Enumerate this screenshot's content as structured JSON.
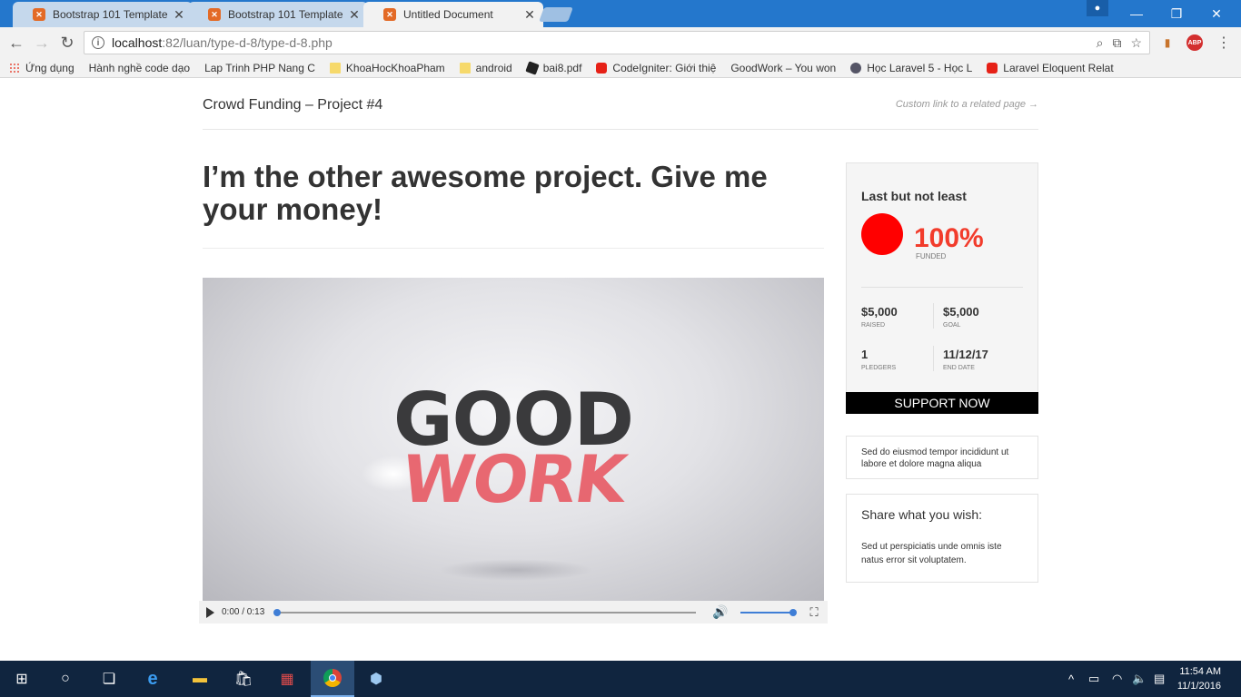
{
  "browser": {
    "tabs": [
      {
        "label": "Bootstrap 101 Template",
        "active": false
      },
      {
        "label": "Bootstrap 101 Template",
        "active": false
      },
      {
        "label": "Untitled Document",
        "active": true
      }
    ],
    "url_host": "localhost",
    "url_path": ":82/luan/type-d-8/type-d-8.php",
    "bookmarks": [
      {
        "label": "Ứng dụng",
        "icon": "apps-icon"
      },
      {
        "label": "Hành nghề code dạo",
        "icon": "page-icon"
      },
      {
        "label": "Lap Trinh PHP Nang C",
        "icon": "page-icon"
      },
      {
        "label": "KhoaHocKhoaPham",
        "icon": "folder-icon"
      },
      {
        "label": "android",
        "icon": "folder-icon"
      },
      {
        "label": "bai8.pdf",
        "icon": "pdf-icon"
      },
      {
        "label": "CodeIgniter: Giới thiệ",
        "icon": "youtube-icon"
      },
      {
        "label": "GoodWork – You won",
        "icon": "page-icon"
      },
      {
        "label": "Học Laravel 5 - Học L",
        "icon": "globe-icon"
      },
      {
        "label": "Laravel Eloquent Relat",
        "icon": "youtube-icon"
      }
    ]
  },
  "site": {
    "title": "Crowd Funding – Project #4",
    "custom_link": "Custom link to a related page →"
  },
  "main": {
    "headline": "I’m the other awesome project. Give me your money!",
    "video": {
      "logo_top": "GOOD",
      "logo_bottom": "WORK",
      "time": "0:00 / 0:13",
      "progress": 0,
      "volume": 1.0
    }
  },
  "sidebar": {
    "card_title": "Last but not least",
    "funded_percent": "100%",
    "funded_label": "FUNDED",
    "raised_value": "$5,000",
    "raised_label": "RAISED",
    "goal_value": "$5,000",
    "goal_label": "GOAL",
    "pledgers_value": "1",
    "pledgers_label": "PLEDGERS",
    "end_date_value": "11/12/17",
    "end_date_label": "END DATE",
    "support_button": "SUPPORT NOW",
    "text_box": "Sed do eiusmod tempor incididunt ut labore et dolore magna aliqua",
    "share_heading": "Share what you wish:",
    "share_text": "Sed ut perspiciatis unde omnis iste natus error sit voluptatem."
  },
  "taskbar": {
    "time": "11:54 AM",
    "date": "11/1/2016"
  },
  "colors": {
    "accent_red": "#f23c2c",
    "circle_red": "#ff0000",
    "tab_strip": "#2477cc",
    "taskbar": "#10253f"
  }
}
